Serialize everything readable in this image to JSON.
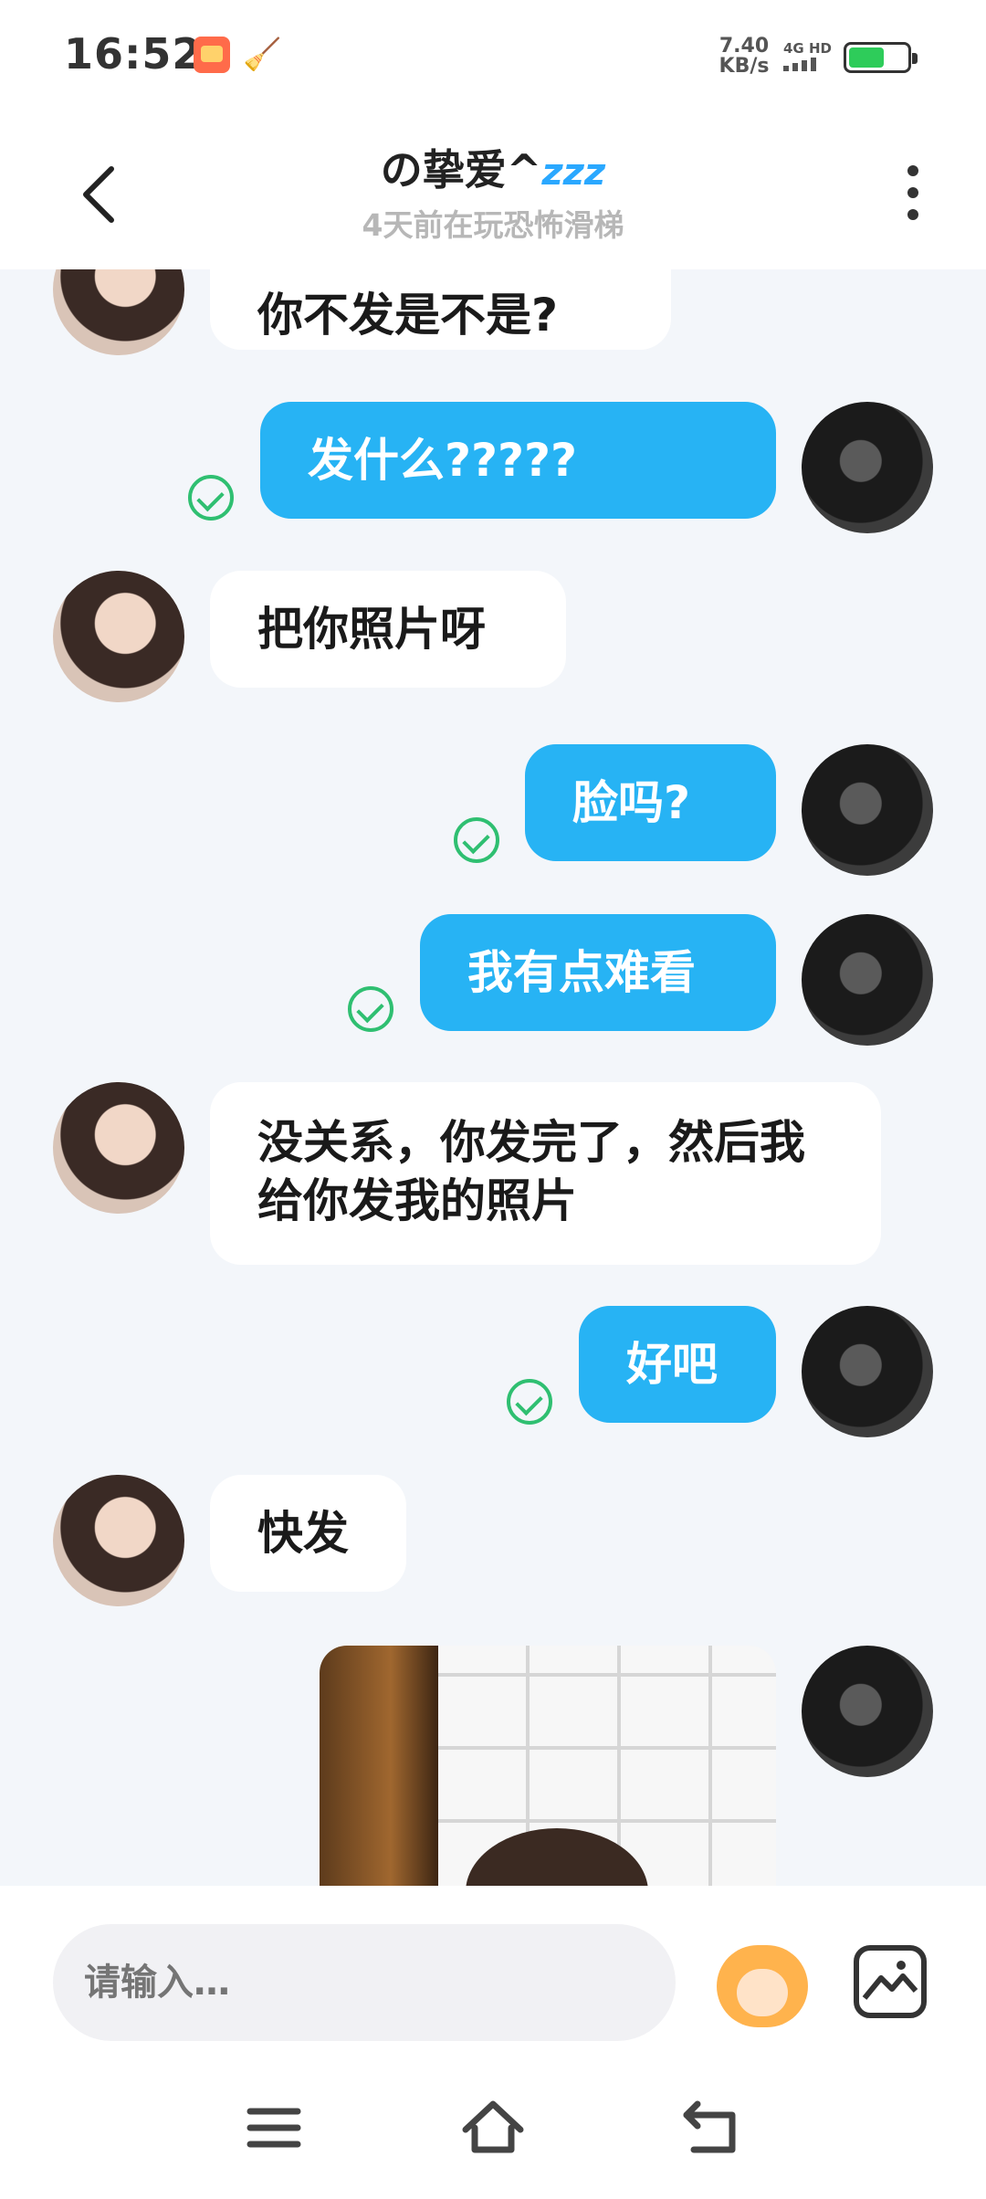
{
  "status_bar": {
    "time": "16:52",
    "net_speed_value": "7.40",
    "net_speed_unit": "KB/s",
    "network": "4G HD",
    "battery_percent": 62,
    "icons": [
      "app-notification-icon",
      "broom-icon",
      "signal-icon",
      "battery-icon"
    ]
  },
  "header": {
    "title": "の挚爱^",
    "title_suffix": "zzz",
    "subtitle": "4天前在玩恐怖滑梯",
    "back_icon": "back-chevron-icon",
    "more_icon": "more-vertical-icon"
  },
  "messages": [
    {
      "sender": "other",
      "text": "你不发是不是?"
    },
    {
      "sender": "me",
      "text": "发什么?????",
      "status": "read"
    },
    {
      "sender": "other",
      "text": "把你照片呀"
    },
    {
      "sender": "me",
      "text": "脸吗?",
      "status": "read"
    },
    {
      "sender": "me",
      "text": "我有点难看",
      "status": "read"
    },
    {
      "sender": "other",
      "text": "没关系，你发完了，然后我给你发我的照片"
    },
    {
      "sender": "me",
      "text": "好吧",
      "status": "read"
    },
    {
      "sender": "other",
      "text": "快发"
    },
    {
      "sender": "me",
      "type": "image"
    }
  ],
  "input_bar": {
    "placeholder": "请输入…",
    "emoji_icon": "emoji-mascot-icon",
    "image_icon": "image-gallery-icon"
  },
  "nav_bar": {
    "icons": [
      "menu-icon",
      "home-icon",
      "back-icon"
    ]
  },
  "colors": {
    "my_bubble": "#27b3f4",
    "other_bubble": "#ffffff",
    "chat_bg": "#f3f6fa",
    "read_check": "#2fbf71",
    "accent": "#2aa8ff"
  }
}
